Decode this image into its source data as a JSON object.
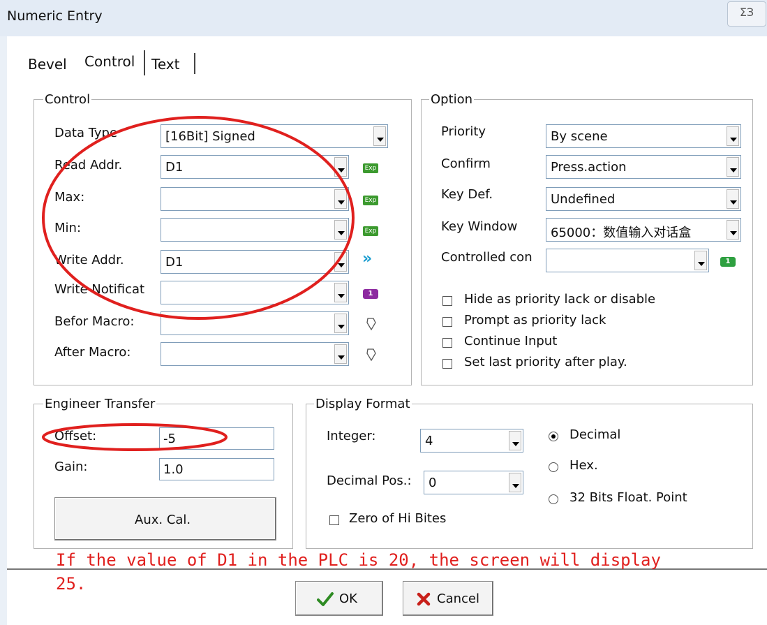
{
  "window": {
    "title": "Numeric Entry",
    "close_glyph": "ΣЗ"
  },
  "tabs": [
    "Bevel",
    "Control",
    "Text"
  ],
  "control_group": {
    "label": "Control",
    "rows": [
      {
        "label": "Data Type",
        "value": "[16Bit] Signed",
        "icon": ""
      },
      {
        "label": "Read Addr.",
        "value": "D1",
        "icon": "exp-icon"
      },
      {
        "label": "Max:",
        "value": "",
        "icon": "exp-icon"
      },
      {
        "label": "Min:",
        "value": "",
        "icon": "exp-icon"
      },
      {
        "label": "Write Addr.",
        "value": "D1",
        "icon": "double-chevron-icon"
      },
      {
        "label": "Write Notificat",
        "value": "",
        "icon": "purple-one-icon"
      },
      {
        "label": "Befor Macro:",
        "value": "",
        "icon": "macro-icon"
      },
      {
        "label": "After Macro:",
        "value": "",
        "icon": "macro-icon"
      }
    ],
    "exp_text": "Exp"
  },
  "option_group": {
    "label": "Option",
    "rows": [
      {
        "label": "Priority",
        "value": "By scene"
      },
      {
        "label": "Confirm",
        "value": "Press.action"
      },
      {
        "label": "Key Def.",
        "value": "Undefined"
      },
      {
        "label": "Key Window",
        "value": "65000：数值输入对话盒"
      },
      {
        "label": "Controlled con",
        "value": ""
      }
    ],
    "one_badge": "1",
    "checkboxes": [
      {
        "label": "Hide as priority lack or disable",
        "checked": false
      },
      {
        "label": "Prompt as priority lack",
        "checked": false
      },
      {
        "label": "Continue Input",
        "checked": false
      },
      {
        "label": "Set last priority after play.",
        "checked": false
      }
    ]
  },
  "engineer_group": {
    "label": "Engineer Transfer",
    "offset_label": "Offset:",
    "offset_value": "-5",
    "gain_label": "Gain:",
    "gain_value": "1.0",
    "aux_button": "Aux. Cal."
  },
  "display_group": {
    "label": "Display Format",
    "integer_label": "Integer:",
    "integer_value": "4",
    "decimal_label": "Decimal Pos.:",
    "decimal_value": "0",
    "zero_label": "Zero of Hi Bites",
    "radios": [
      {
        "label": "Decimal",
        "selected": true
      },
      {
        "label": "Hex.",
        "selected": false
      },
      {
        "label": "32 Bits Float. Point",
        "selected": false
      }
    ]
  },
  "annotation": {
    "line1": "If the value of D1 in the PLC is 20, the screen will display",
    "line2": "25."
  },
  "buttons": {
    "ok": "OK",
    "cancel": "Cancel"
  },
  "colors": {
    "annotation_red": "#e0201e",
    "exp_green": "#3c9a2f",
    "chevron_blue": "#1a9dd0",
    "purple_badge": "#8d2aa0"
  }
}
